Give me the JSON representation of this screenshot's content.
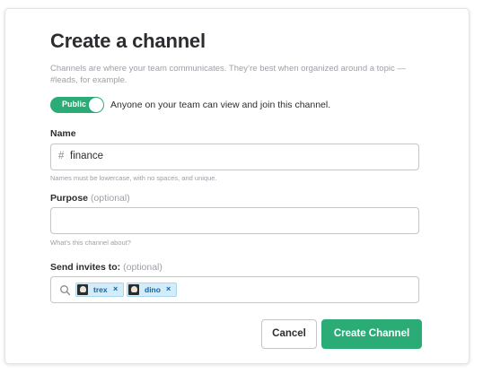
{
  "dialog": {
    "title": "Create a channel",
    "description": "Channels are where your team communicates. They’re best when organized around a topic — #leads, for example."
  },
  "visibility": {
    "toggle_label": "Public",
    "toggle_on": true,
    "description": "Anyone on your team can view and join this channel."
  },
  "name_field": {
    "label": "Name",
    "prefix": "#",
    "value": "finance",
    "hint": "Names must be lowercase, with no spaces, and unique."
  },
  "purpose_field": {
    "label": "Purpose",
    "optional": "(optional)",
    "value": "",
    "hint": "What’s this channel about?"
  },
  "invites_field": {
    "label": "Send invites to:",
    "optional": "(optional)",
    "invitees": [
      {
        "name": "trex"
      },
      {
        "name": "dino"
      }
    ],
    "remove_glyph": "×"
  },
  "buttons": {
    "cancel": "Cancel",
    "create": "Create Channel"
  },
  "colors": {
    "accent_green": "#2bac76",
    "chip_background": "#d2ecf9",
    "chip_text": "#1264a3",
    "muted_text": "#9e9ea6"
  },
  "icons": {
    "search": "search-icon",
    "remove": "close-icon"
  }
}
